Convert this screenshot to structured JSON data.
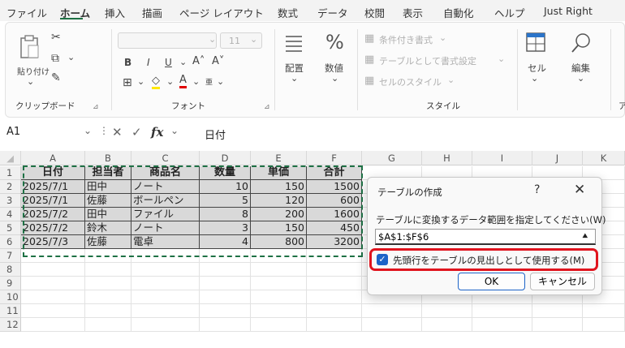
{
  "menu": {
    "tabs": [
      "ファイル",
      "ホーム",
      "挿入",
      "描画",
      "ページ レイアウト",
      "数式",
      "データ",
      "校閲",
      "表示",
      "自動化",
      "ヘルプ",
      "Just Right"
    ],
    "active": "ホーム"
  },
  "ribbon": {
    "clipboard": {
      "paste": "貼り付け",
      "label": "クリップボード"
    },
    "font": {
      "size": "11",
      "label": "フォント"
    },
    "alignment": {
      "label": "配置"
    },
    "number": {
      "label": "数値"
    },
    "styles": {
      "conditional": "条件付き書式",
      "table": "テーブルとして書式設定",
      "cell_styles": "セルのスタイル",
      "label": "スタイル"
    },
    "cells": {
      "label": "セル"
    },
    "editing": {
      "label": "編集"
    },
    "cutoff": "ア"
  },
  "formula_bar": {
    "name_box": "A1",
    "value": "日付"
  },
  "sheet": {
    "columns": [
      "A",
      "B",
      "C",
      "D",
      "E",
      "F",
      "G",
      "H",
      "I",
      "J",
      "K"
    ],
    "rows": [
      "1",
      "2",
      "3",
      "4",
      "5",
      "6",
      "7",
      "8",
      "9",
      "10",
      "11",
      "12"
    ],
    "headers": [
      "日付",
      "担当者",
      "商品名",
      "数量",
      "単価",
      "合計"
    ],
    "data": [
      [
        "2025/7/1",
        "田中",
        "ノート",
        "10",
        "150",
        "1500"
      ],
      [
        "2025/7/1",
        "佐藤",
        "ボールペン",
        "5",
        "120",
        "600"
      ],
      [
        "2025/7/2",
        "田中",
        "ファイル",
        "8",
        "200",
        "1600"
      ],
      [
        "2025/7/2",
        "鈴木",
        "ノート",
        "3",
        "150",
        "450"
      ],
      [
        "2025/7/3",
        "佐藤",
        "電卓",
        "4",
        "800",
        "3200"
      ]
    ]
  },
  "dialog": {
    "title": "テーブルの作成",
    "help": "?",
    "close": "✕",
    "prompt": "テーブルに変換するデータ範囲を指定してください(W)",
    "range": "$A$1:$F$6",
    "has_headers": "先頭行をテーブルの見出しとして使用する(M)",
    "ok": "OK",
    "cancel": "キャンセル"
  }
}
